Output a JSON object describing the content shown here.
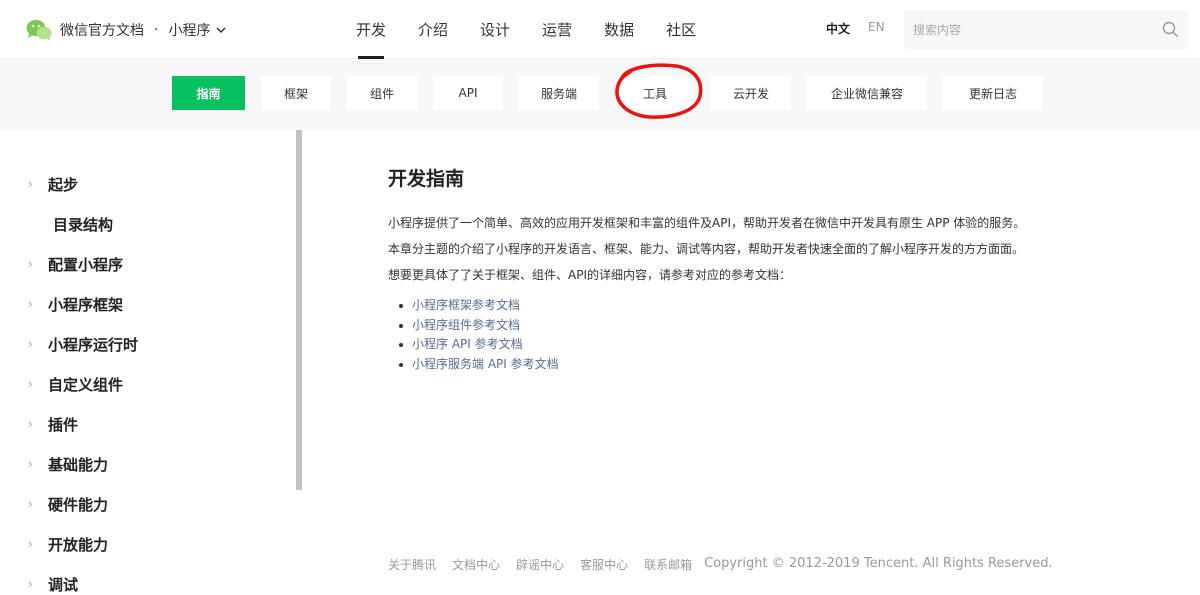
{
  "header": {
    "brand_title": "微信官方文档",
    "brand_dot": "·",
    "brand_sub": "小程序",
    "nav": [
      "开发",
      "介绍",
      "设计",
      "运营",
      "数据",
      "社区"
    ],
    "active_nav": "开发",
    "lang_zh": "中文",
    "lang_en": "EN",
    "search_placeholder": "搜索内容"
  },
  "subnav": {
    "tabs": [
      "指南",
      "框架",
      "组件",
      "API",
      "服务端",
      "工具",
      "云开发",
      "企业微信兼容",
      "更新日志"
    ],
    "active": "指南",
    "accent_color": "#07c160",
    "annotation": "red hand-drawn circle around 工具"
  },
  "sidebar": {
    "items": [
      {
        "label": "起步",
        "expandable": true
      },
      {
        "label": "目录结构",
        "expandable": false
      },
      {
        "label": "配置小程序",
        "expandable": true
      },
      {
        "label": "小程序框架",
        "expandable": true
      },
      {
        "label": "小程序运行时",
        "expandable": true
      },
      {
        "label": "自定义组件",
        "expandable": true
      },
      {
        "label": "插件",
        "expandable": true
      },
      {
        "label": "基础能力",
        "expandable": true
      },
      {
        "label": "硬件能力",
        "expandable": true
      },
      {
        "label": "开放能力",
        "expandable": true
      },
      {
        "label": "调试",
        "expandable": true
      }
    ]
  },
  "content": {
    "title": "开发指南",
    "paragraphs": [
      "小程序提供了一个简单、高效的应用开发框架和丰富的组件及API，帮助开发者在微信中开发具有原生 APP 体验的服务。",
      "本章分主题的介绍了小程序的开发语言、框架、能力、调试等内容，帮助开发者快速全面的了解小程序开发的方方面面。",
      "想要更具体了了关于框架、组件、API的详细内容，请参考对应的参考文档："
    ],
    "links": [
      "小程序框架参考文档",
      "小程序组件参考文档",
      "小程序 API 参考文档",
      "小程序服务端 API 参考文档"
    ]
  },
  "footer": {
    "links": [
      "关于腾讯",
      "文档中心",
      "辟谣中心",
      "客服中心",
      "联系邮箱"
    ],
    "copyright": "Copyright © 2012-2019 Tencent. All Rights Reserved."
  }
}
